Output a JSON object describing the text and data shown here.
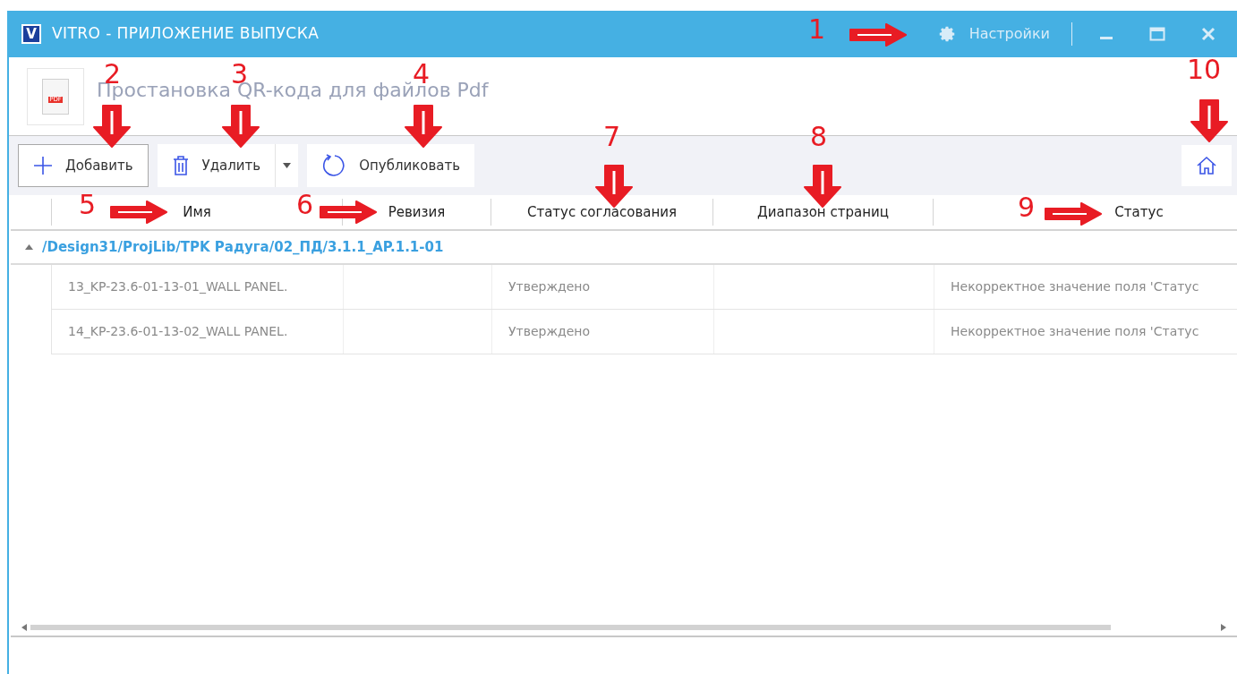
{
  "window": {
    "title": "VITRO - ПРИЛОЖЕНИЕ ВЫПУСКА",
    "app_letter": "V",
    "settings": "Настройки"
  },
  "header": {
    "title": "Простановка QR-кода для файлов Pdf",
    "icon_label": "PDF"
  },
  "toolbar": [
    {
      "kind": "add",
      "label": "Добавить"
    },
    {
      "kind": "delete",
      "label": "Удалить"
    },
    {
      "kind": "publish",
      "label": "Опубликовать"
    }
  ],
  "table": {
    "columns": [
      "Имя",
      "Ревизия",
      "Статус согласования",
      "Диапазон страниц",
      "Статус"
    ],
    "group": {
      "path": "/Design31/ProjLib/TPK Радуга/02_ПД/3.1.1_AP.1.1-01",
      "expanded": true
    },
    "rows": [
      [
        "13_KP-23.6-01-13-01_WALL PANEL.",
        "",
        "Утверждено",
        "",
        "Некорректное значение поля 'Статус"
      ],
      [
        "14_KP-23.6-01-13-02_WALL PANEL.",
        "",
        "Утверждено",
        "",
        "Некорректное значение поля 'Статус"
      ]
    ]
  },
  "annotations": [
    {
      "label": "1",
      "kind": "right"
    },
    {
      "label": "2",
      "kind": "down"
    },
    {
      "label": "3",
      "kind": "down"
    },
    {
      "label": "4",
      "kind": "down"
    },
    {
      "label": "5",
      "kind": "right"
    },
    {
      "label": "6",
      "kind": "right"
    },
    {
      "label": "7",
      "kind": "down"
    },
    {
      "label": "8",
      "kind": "down"
    },
    {
      "label": "9",
      "kind": "right"
    },
    {
      "label": "10",
      "kind": "down"
    }
  ]
}
